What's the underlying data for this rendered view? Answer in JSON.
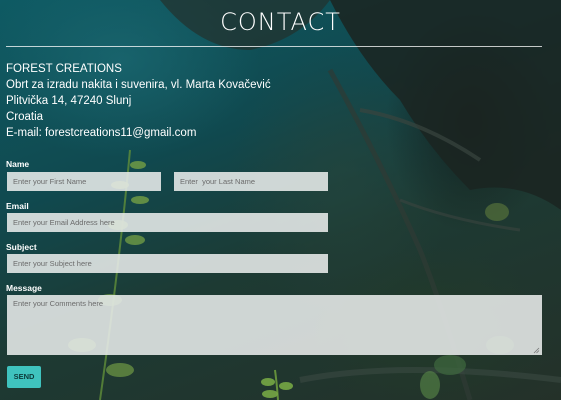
{
  "page": {
    "title": "CONTACT"
  },
  "company": {
    "name": "FOREST CREATIONS",
    "description": "Obrt za izradu nakita i suvenira, vl. Marta Kovačević",
    "street": "Plitvička 14, 47240 Slunj",
    "country": "Croatia",
    "email_line": "E-mail: forestcreations11@gmail.com"
  },
  "form": {
    "name_label": "Name",
    "first_name_placeholder": "Enter your First Name",
    "last_name_placeholder": "Enter  your Last Name",
    "email_label": "Email",
    "email_placeholder": "Enter your Email Address here",
    "subject_label": "Subject",
    "subject_placeholder": "Enter your Subject here",
    "message_label": "Message",
    "message_placeholder": "Enter your Comments here",
    "send_label": "SEND"
  },
  "icons": {
    "resize": "resize-grip-icon"
  },
  "colors": {
    "send_button": "#3fc3be",
    "field_background": "#e8ecea"
  }
}
